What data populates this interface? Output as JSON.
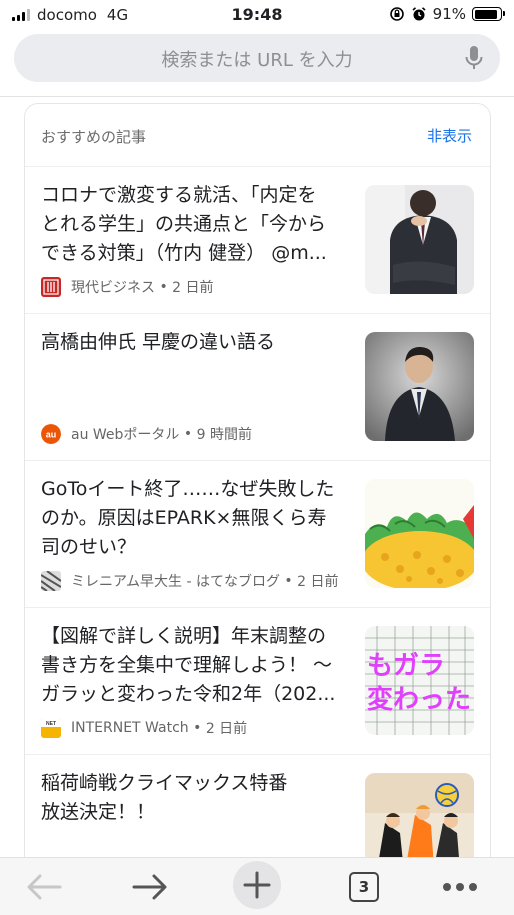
{
  "status_bar": {
    "carrier": "docomo",
    "network": "4G",
    "time": "19:48",
    "battery_percent": "91%",
    "battery_level": 0.91
  },
  "search": {
    "placeholder": "検索または URL を入力"
  },
  "feed": {
    "title": "おすすめの記事",
    "hide_label": "非表示",
    "articles": [
      {
        "title": "コロナで激変する就活、「内定を\nとれる学生」の共通点と「今から\nできる対策」（竹内 健登） @m...",
        "source": "現代ビジネス",
        "time": "2 日前",
        "thumbnail_icon": "person-photo-thumbnail"
      },
      {
        "title": "高橋由伸氏 早慶の違い語る",
        "source": "au Webポータル",
        "time": "9 時間前",
        "thumbnail_icon": "portrait-photo-thumbnail"
      },
      {
        "title": "GoToイート終了……なぜ失敗した\nのか。原因はEPARK×無限くら寿\n司のせい？",
        "source": "ミレニアム早大生 - はてなブログ",
        "time": "2 日前",
        "thumbnail_icon": "food-illustration-thumbnail"
      },
      {
        "title": "【図解で詳しく説明】年末調整の\n書き方を全集中で理解しよう！ ～\nガラッと変わった令和2年（202...",
        "source": "INTERNET Watch",
        "time": "2 日前",
        "thumbnail_icon": "tax-form-thumbnail",
        "thumbnail_text": "もガラ 変わった"
      },
      {
        "title": "稲荷崎戦クライマックス特番\n放送決定！！",
        "source": "",
        "time": "",
        "thumbnail_icon": "anime-poster-thumbnail"
      }
    ]
  },
  "toolbar": {
    "back_icon": "back-arrow-icon",
    "forward_icon": "forward-arrow-icon",
    "new_tab_icon": "plus-icon",
    "tab_count": "3",
    "menu_icon": "more-dots-icon"
  },
  "colors": {
    "accent": "#1a73e8",
    "search_bg": "#ebecef",
    "toolbar_bg": "#f6f6f6"
  }
}
